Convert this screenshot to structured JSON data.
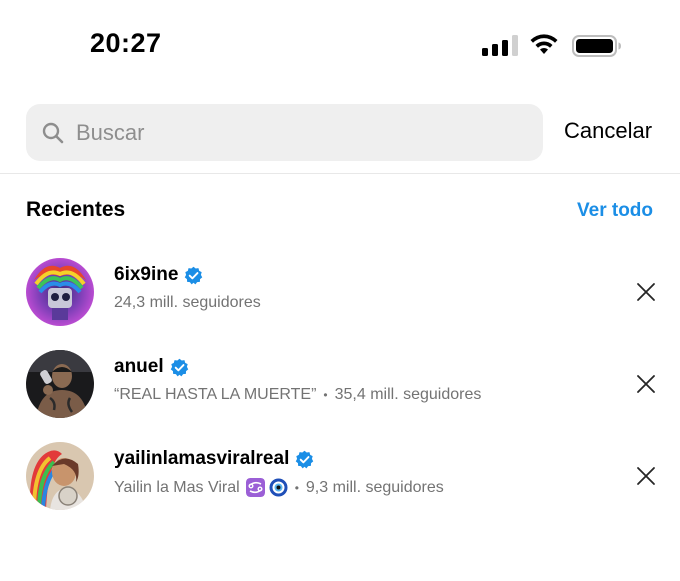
{
  "status_bar": {
    "time": "20:27"
  },
  "search": {
    "placeholder": "Buscar",
    "value": "",
    "cancel_label": "Cancelar"
  },
  "recents": {
    "title": "Recientes",
    "see_all_label": "Ver todo",
    "items": [
      {
        "username": "6ix9ine",
        "verified": true,
        "subtitle": "24,3 mill. seguidores"
      },
      {
        "username": "anuel",
        "verified": true,
        "name": "“REAL HASTA LA MUERTE”",
        "followers": "35,4 mill. seguidores"
      },
      {
        "username": "yailinlamasviralreal",
        "verified": true,
        "name": "Yailin la Mas Viral",
        "followers": "9,3 mill. seguidores",
        "emojis": [
          "cancer-sign-emoji",
          "nazar-amulet-emoji"
        ]
      }
    ]
  },
  "colors": {
    "accent": "#1b8ee6",
    "verified": "#1b8ee6",
    "secondary_text": "#737373",
    "search_bg": "#efefef"
  }
}
